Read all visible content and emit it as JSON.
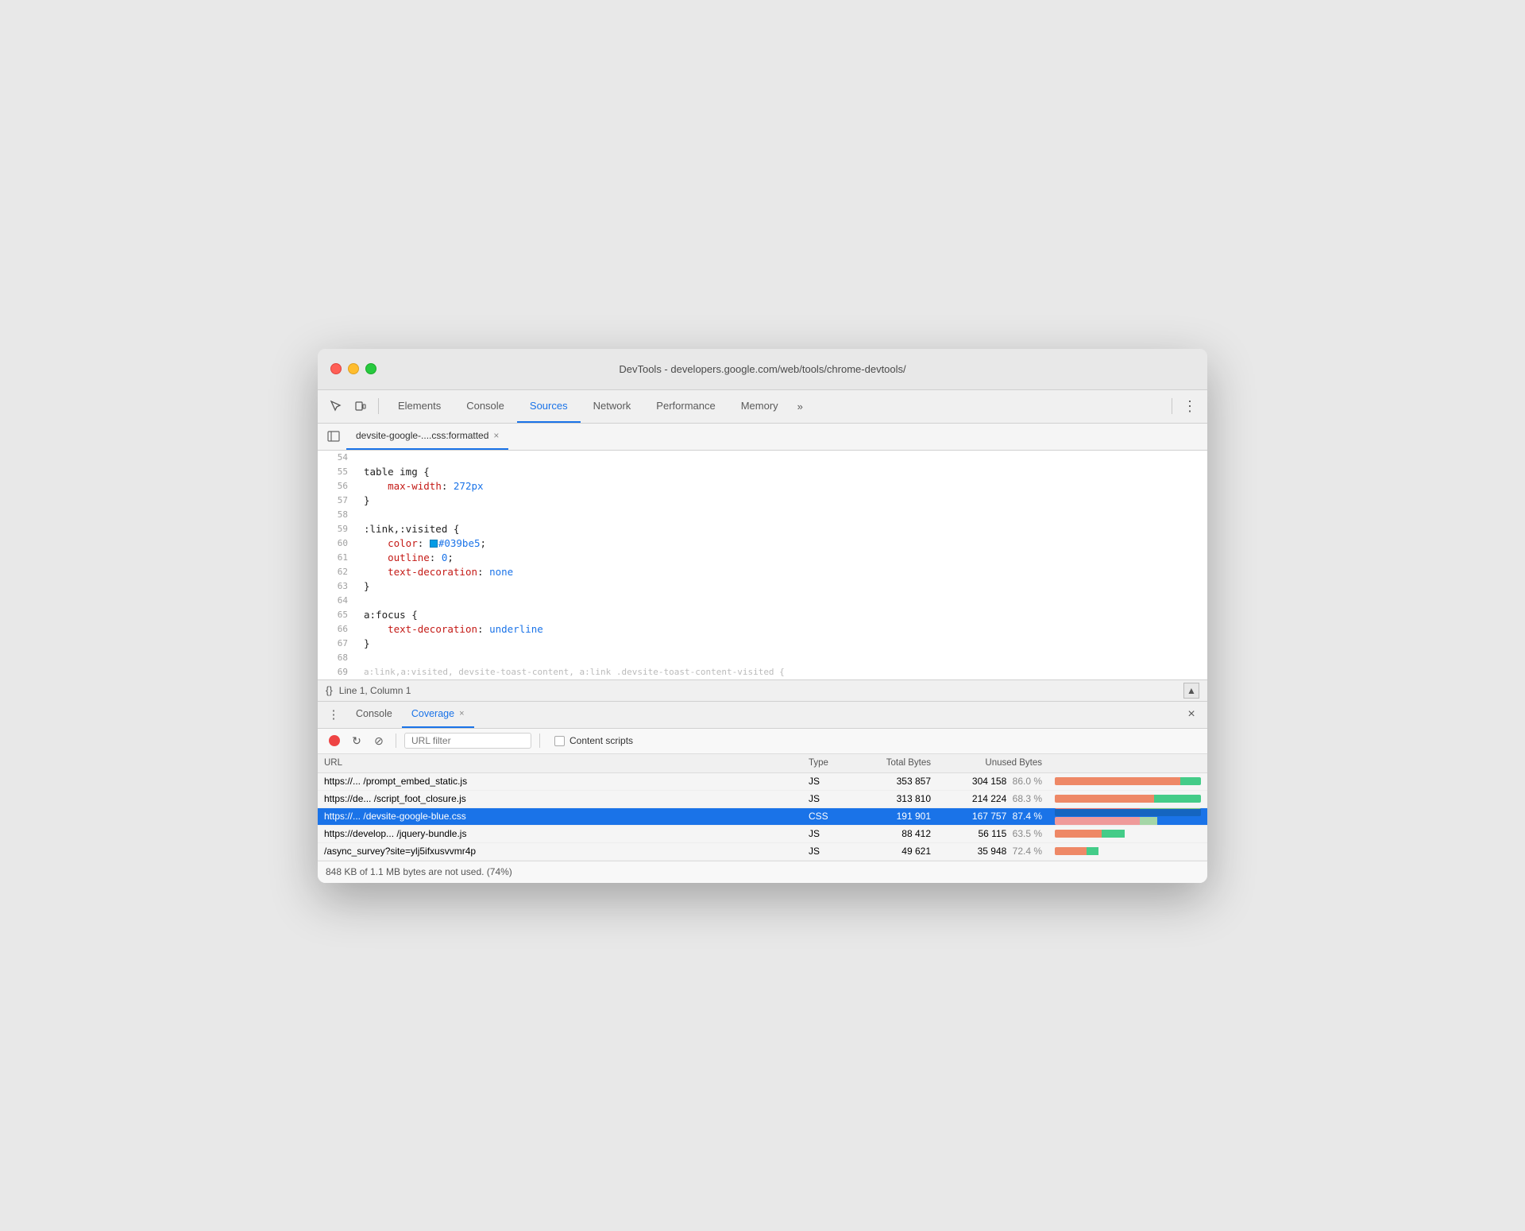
{
  "window": {
    "title": "DevTools - developers.google.com/web/tools/chrome-devtools/"
  },
  "toolbar": {
    "tabs": [
      {
        "label": "Elements",
        "active": false
      },
      {
        "label": "Console",
        "active": false
      },
      {
        "label": "Sources",
        "active": true
      },
      {
        "label": "Network",
        "active": false
      },
      {
        "label": "Performance",
        "active": false
      },
      {
        "label": "Memory",
        "active": false
      },
      {
        "label": "»",
        "active": false
      }
    ]
  },
  "file_tab": {
    "name": "devsite-google-....css:formatted",
    "close": "×"
  },
  "code": {
    "lines": [
      {
        "num": "54",
        "gutter": false,
        "content": ""
      },
      {
        "num": "55",
        "gutter": false,
        "content_html": "table img {"
      },
      {
        "num": "56",
        "gutter": false,
        "content_html": "    <span class='prop'>max-width</span>: <span class='val-blue'>272px</span>"
      },
      {
        "num": "57",
        "gutter": false,
        "content_html": "}"
      },
      {
        "num": "58",
        "gutter": false,
        "content": ""
      },
      {
        "num": "59",
        "gutter": false,
        "content_html": ":link,:visited {"
      },
      {
        "num": "60",
        "gutter": false,
        "content_html": "    <span class='prop'>color</span>: <span class='color-swatch-inline'></span><span class='val-blue'>#039be5</span>;"
      },
      {
        "num": "61",
        "gutter": false,
        "content_html": "    <span class='prop'>outline</span>: <span class='val-blue'>0</span>;"
      },
      {
        "num": "62",
        "gutter": false,
        "content_html": "    <span class='prop'>text-decoration</span>: <span class='val-blue'>none</span>"
      },
      {
        "num": "63",
        "gutter": false,
        "content_html": "}"
      },
      {
        "num": "64",
        "gutter": false,
        "content": ""
      },
      {
        "num": "65",
        "gutter": true,
        "content_html": "a:focus {"
      },
      {
        "num": "66",
        "gutter": false,
        "content_html": "    <span class='prop'>text-decoration</span>: <span class='val-blue'>underline</span>"
      },
      {
        "num": "67",
        "gutter": false,
        "content_html": "}"
      },
      {
        "num": "68",
        "gutter": false,
        "content": ""
      },
      {
        "num": "69",
        "gutter": false,
        "content_html": "<span class='code-fade'>a:link,a:visited, devsite-toast-content, a:link .devsite-toast-content-visited {</span>"
      }
    ]
  },
  "status_bar": {
    "position": "Line 1, Column 1"
  },
  "bottom_panel": {
    "tabs": [
      {
        "label": "Console",
        "active": false,
        "closeable": false
      },
      {
        "label": "Coverage",
        "active": true,
        "closeable": true
      }
    ]
  },
  "coverage": {
    "url_filter_placeholder": "URL filter",
    "content_scripts_label": "Content scripts",
    "columns": {
      "url": "URL",
      "type": "Type",
      "total_bytes": "Total Bytes",
      "unused_bytes": "Unused Bytes"
    },
    "rows": [
      {
        "url": "https://... /prompt_embed_static.js",
        "type": "JS",
        "total_bytes": "353 857",
        "unused_bytes": "304 158",
        "unused_pct": "86.0 %",
        "bar_unused_pct": 86,
        "bar_used_pct": 14,
        "selected": false
      },
      {
        "url": "https://de... /script_foot_closure.js",
        "type": "JS",
        "total_bytes": "313 810",
        "unused_bytes": "214 224",
        "unused_pct": "68.3 %",
        "bar_unused_pct": 68,
        "bar_used_pct": 32,
        "selected": false
      },
      {
        "url": "https://... /devsite-google-blue.css",
        "type": "CSS",
        "total_bytes": "191 901",
        "unused_bytes": "167 757",
        "unused_pct": "87.4 %",
        "bar_unused_pct": 58,
        "bar_used_pct": 12,
        "selected": true
      },
      {
        "url": "https://develop... /jquery-bundle.js",
        "type": "JS",
        "total_bytes": "88 412",
        "unused_bytes": "56 115",
        "unused_pct": "63.5 %",
        "bar_unused_pct": 32,
        "bar_used_pct": 16,
        "selected": false
      },
      {
        "url": "/async_survey?site=ylj5ifxusvvmr4p",
        "type": "JS",
        "total_bytes": "49 621",
        "unused_bytes": "35 948",
        "unused_pct": "72.4 %",
        "bar_unused_pct": 22,
        "bar_used_pct": 8,
        "selected": false
      }
    ],
    "footer": "848 KB of 1.1 MB bytes are not used. (74%)"
  }
}
